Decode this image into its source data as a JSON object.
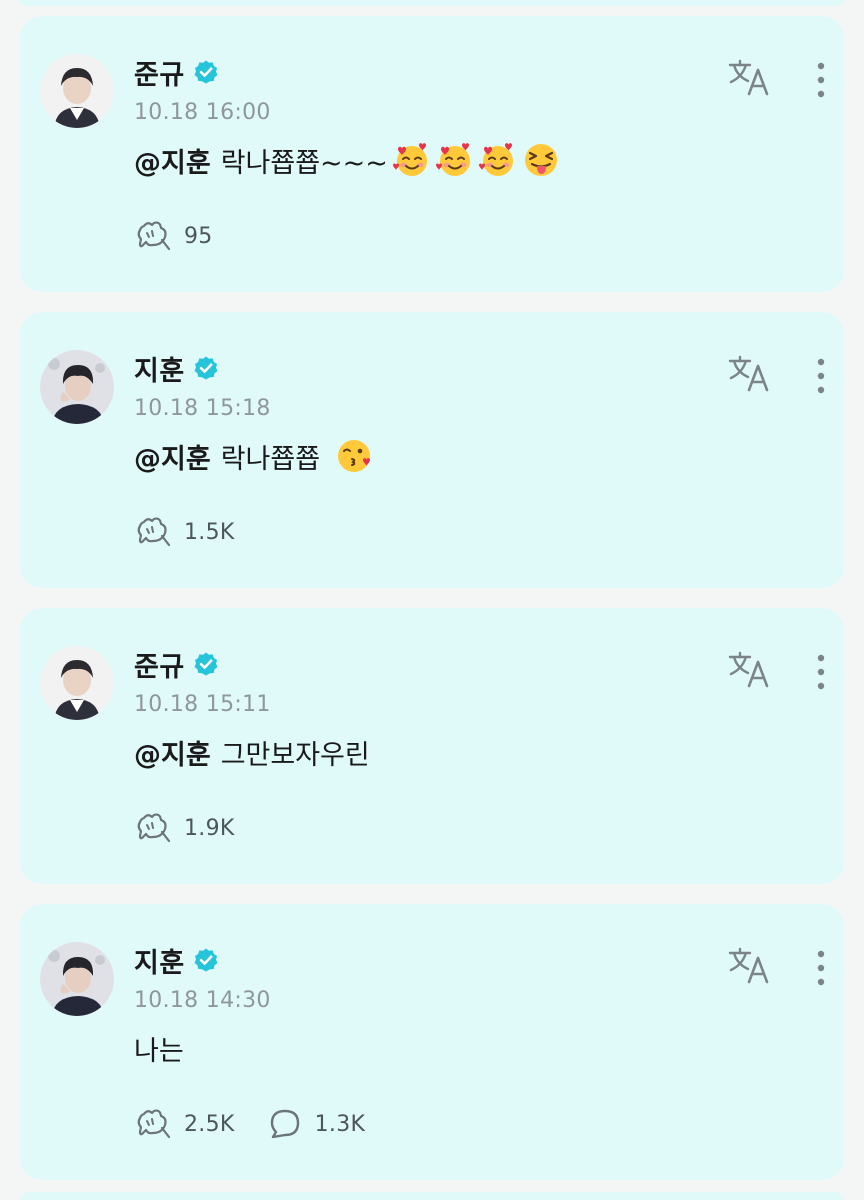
{
  "posts": [
    {
      "author": "준규",
      "time": "10.18 16:00",
      "mention": "@지훈",
      "text": "락나쬽쬽~~~",
      "emojis": [
        "smiling-face-with-hearts",
        "smiling-face-with-hearts",
        "smiling-face-with-hearts",
        "squinting-face-with-tongue"
      ],
      "likes": "95",
      "comments": ""
    },
    {
      "author": "지훈",
      "time": "10.18 15:18",
      "mention": "@지훈",
      "text": "락나쬽쬽",
      "emojis": [
        "face-blowing-a-kiss"
      ],
      "likes": "1.5K",
      "comments": ""
    },
    {
      "author": "준규",
      "time": "10.18 15:11",
      "mention": "@지훈",
      "text": "그만보자우린",
      "emojis": [],
      "likes": "1.9K",
      "comments": ""
    },
    {
      "author": "지훈",
      "time": "10.18 14:30",
      "mention": "",
      "text": "나는",
      "emojis": [],
      "likes": "2.5K",
      "comments": "1.3K"
    }
  ],
  "colors": {
    "card_background": "#e0fafa",
    "page_background": "#f4f6f6",
    "verified_badge": "#25c4d8",
    "timestamp": "#8e9799",
    "icon_gray": "#6b7476"
  },
  "icons": {
    "verified": "verified-badge-icon",
    "translate": "translate-icon",
    "more": "more-options-icon",
    "like": "like-reaction-icon",
    "comment": "comment-bubble-icon"
  }
}
